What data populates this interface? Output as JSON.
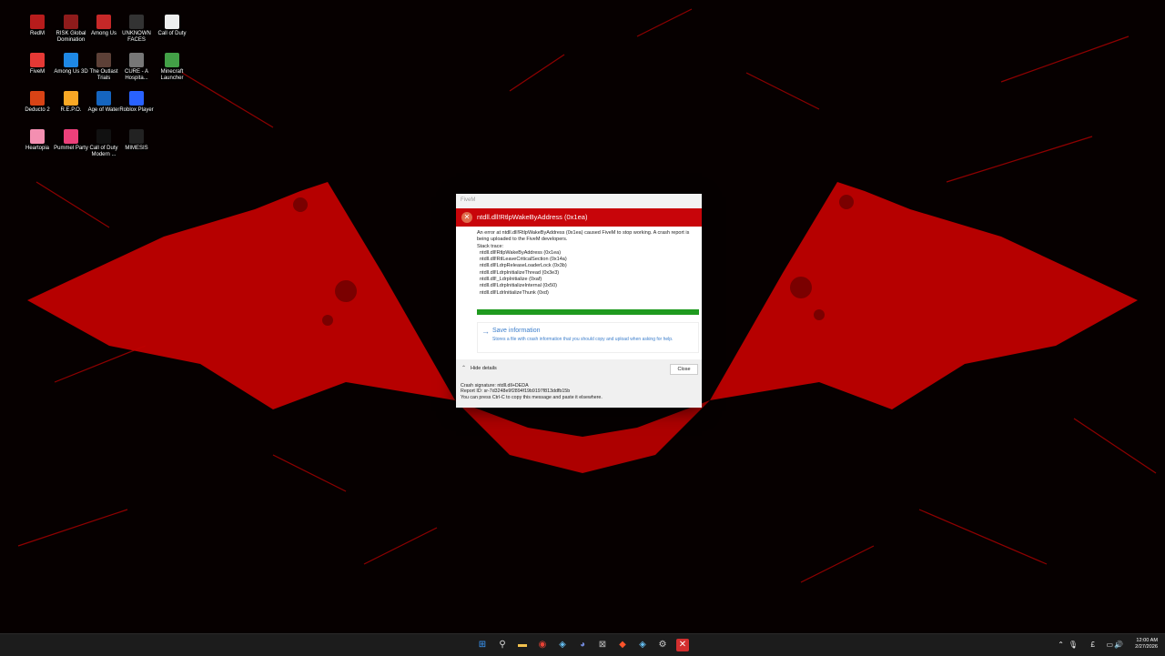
{
  "desktop": {
    "icons": [
      {
        "label": "RedM",
        "color": "#b71c1c"
      },
      {
        "label": "RISK Global Domination",
        "color": "#8e1b1b"
      },
      {
        "label": "Among Us",
        "color": "#c62828"
      },
      {
        "label": "UNKNOWN FACES",
        "color": "#333333"
      },
      {
        "label": "Call of Duty",
        "color": "#eeeeee"
      },
      {
        "label": "FiveM",
        "color": "#e53935"
      },
      {
        "label": "Among Us 3D",
        "color": "#1e88e5"
      },
      {
        "label": "The Outlast Trials",
        "color": "#5d4037"
      },
      {
        "label": "CURE - A Hospita...",
        "color": "#777777"
      },
      {
        "label": "Minecraft Launcher",
        "color": "#43a047"
      },
      {
        "label": "Deducto 2",
        "color": "#d84315"
      },
      {
        "label": "R.E.P.O.",
        "color": "#f9a825"
      },
      {
        "label": "Age of Water",
        "color": "#1565c0"
      },
      {
        "label": "Roblox Player",
        "color": "#2962ff"
      },
      {
        "label": "Heartopia",
        "color": "#f48fb1"
      },
      {
        "label": "Pummel Party",
        "color": "#ec407a"
      },
      {
        "label": "Call of Duty Modern ...",
        "color": "#111111"
      },
      {
        "label": "MIMESIS",
        "color": "#222222"
      }
    ]
  },
  "dialog": {
    "window_title": "FiveM",
    "header": "ntdll.dll!RtlpWakeByAddress (0x1ea)",
    "message": "An error at ntdll.dll!RtlpWakeByAddress (0x1ea) caused FiveM to stop working. A crash report is being uploaded to the FiveM developers.",
    "stack_label": "Stack trace:",
    "stack_trace": [
      "ntdll.dll!RtlpWakeByAddress (0x1ea)",
      "ntdll.dll!RtlLeaveCriticalSection (0x14a)",
      "ntdll.dll!LdrpReleaseLoaderLock (0x3b)",
      "ntdll.dll!LdrpInitializeThread (0x3e3)",
      "ntdll.dll!_LdrpInitialize (0xaf)",
      "ntdll.dll!LdrpInitializeInternal (0x50)",
      "ntdll.dll!LdrInitializeThunk (0xd)"
    ],
    "progress": 1.0,
    "save_title": "Save information",
    "save_desc": "Stores a file with crash information that you should copy and upload when asking for help.",
    "hide_details": "Hide details",
    "close_label": "Close",
    "crash_signature": "Crash signature: ntdll.dll+DEDA",
    "report_id": "Report ID: sr-7d3248e9f2894f19b9197f813ddfb15b",
    "copy_hint": "You can press Ctrl-C to copy this message and paste it elsewhere."
  },
  "taskbar": {
    "apps": [
      {
        "name": "windows-start-icon",
        "glyph": "⊞",
        "color": "#3b9cff"
      },
      {
        "name": "search-icon",
        "glyph": "⚲",
        "color": "#dddddd"
      },
      {
        "name": "file-explorer-icon",
        "glyph": "▬",
        "color": "#f2c14e"
      },
      {
        "name": "chrome-icon",
        "glyph": "◉",
        "color": "#e94235"
      },
      {
        "name": "steam-icon",
        "glyph": "◈",
        "color": "#66c0f4"
      },
      {
        "name": "discord-icon",
        "glyph": "◕",
        "color": "#7289da"
      },
      {
        "name": "xbox-icon",
        "glyph": "⊠",
        "color": "#bbbbbb"
      },
      {
        "name": "brave-icon",
        "glyph": "◆",
        "color": "#fb542b"
      },
      {
        "name": "steam-icon-2",
        "glyph": "◈",
        "color": "#66c0f4"
      },
      {
        "name": "settings-icon",
        "glyph": "⚙",
        "color": "#cccccc"
      },
      {
        "name": "fivem-crash-icon",
        "glyph": "✕",
        "color": "#ffffff"
      }
    ],
    "time": "12:00 AM",
    "date": "2/27/2026"
  }
}
